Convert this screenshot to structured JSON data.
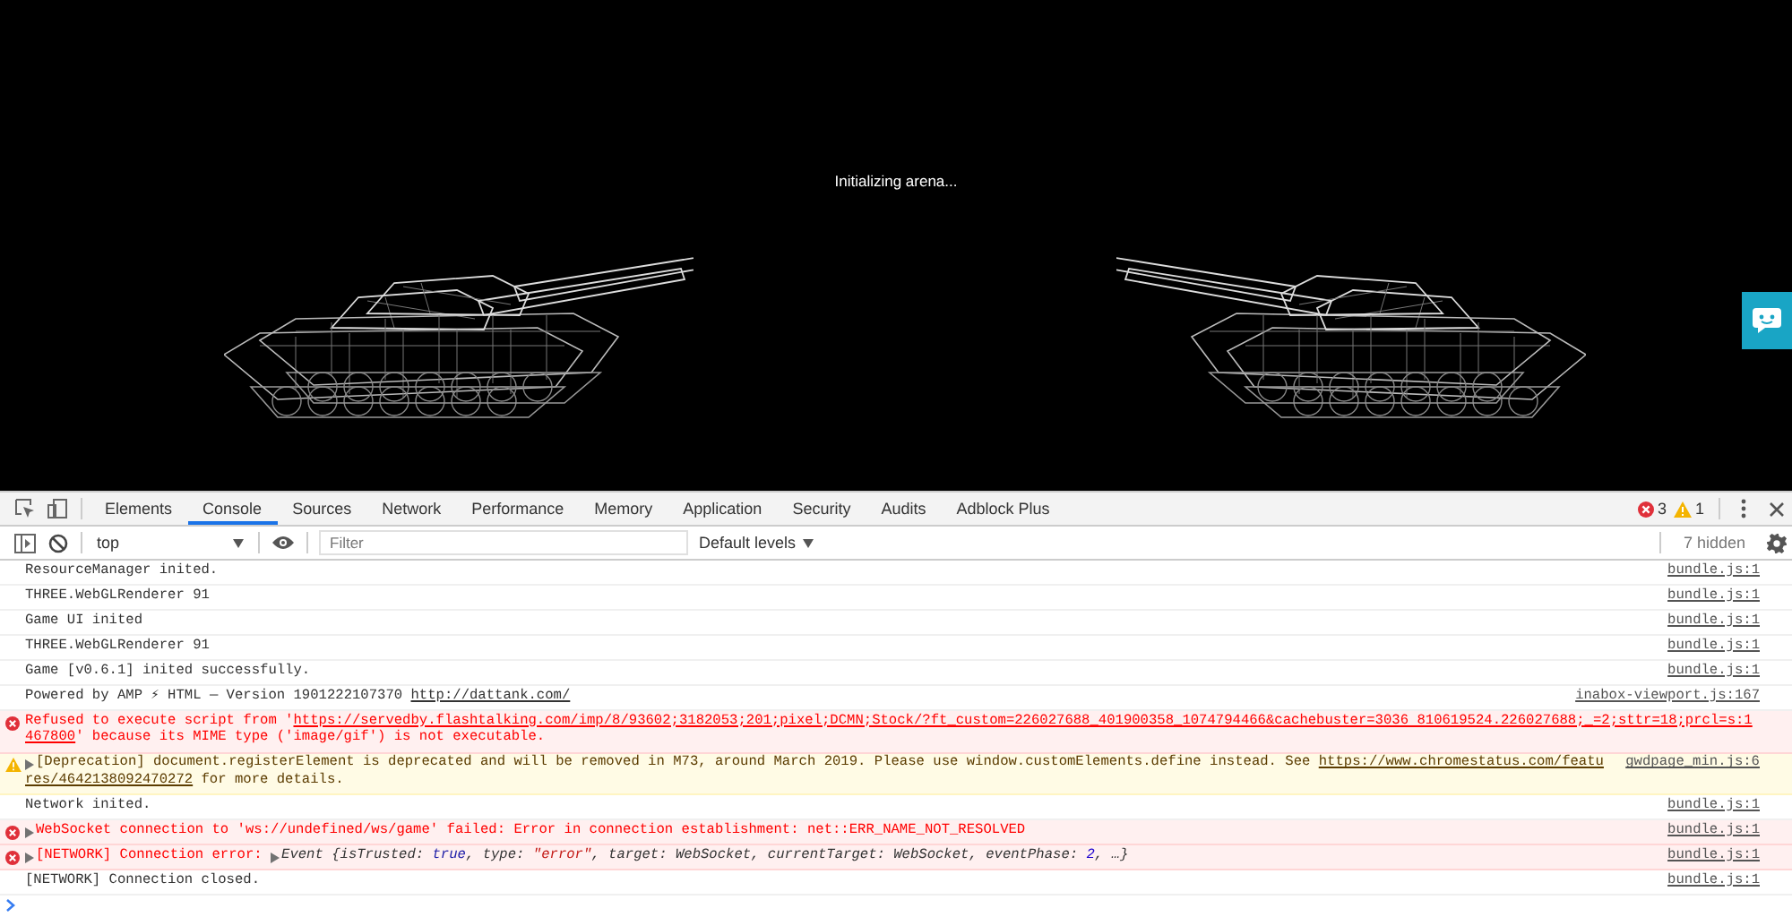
{
  "game": {
    "status": "Initializing arena..."
  },
  "devtools": {
    "tabs": [
      {
        "label": "Elements",
        "selected": false
      },
      {
        "label": "Console",
        "selected": true
      },
      {
        "label": "Sources",
        "selected": false
      },
      {
        "label": "Network",
        "selected": false
      },
      {
        "label": "Performance",
        "selected": false
      },
      {
        "label": "Memory",
        "selected": false
      },
      {
        "label": "Application",
        "selected": false
      },
      {
        "label": "Security",
        "selected": false
      },
      {
        "label": "Audits",
        "selected": false
      },
      {
        "label": "Adblock Plus",
        "selected": false
      }
    ],
    "error_count": "3",
    "warning_count": "1",
    "toolbar": {
      "context": "top",
      "filter": {
        "placeholder": "Filter"
      },
      "levels": "Default levels",
      "hidden": "7 hidden"
    },
    "console": [
      {
        "kind": "info",
        "expandable": false,
        "source": "bundle.js:1",
        "lines": [
          [
            {
              "kind": "text",
              "text": "ResourceManager inited."
            }
          ]
        ]
      },
      {
        "kind": "info",
        "expandable": false,
        "source": "bundle.js:1",
        "lines": [
          [
            {
              "kind": "text",
              "text": "THREE.WebGLRenderer 91"
            }
          ]
        ]
      },
      {
        "kind": "info",
        "expandable": false,
        "source": "bundle.js:1",
        "lines": [
          [
            {
              "kind": "text",
              "text": "Game UI inited"
            }
          ]
        ]
      },
      {
        "kind": "info",
        "expandable": false,
        "source": "bundle.js:1",
        "lines": [
          [
            {
              "kind": "text",
              "text": "THREE.WebGLRenderer 91"
            }
          ]
        ]
      },
      {
        "kind": "info",
        "expandable": false,
        "source": "bundle.js:1",
        "lines": [
          [
            {
              "kind": "text",
              "text": "Game [v0.6.1] inited successfully."
            }
          ]
        ]
      },
      {
        "kind": "info",
        "expandable": false,
        "source": "inabox-viewport.js:167",
        "lines": [
          [
            {
              "kind": "text",
              "text": "Powered by AMP ⚡ HTML — Version 1901222107370 "
            },
            {
              "kind": "link",
              "text": "http://dattank.com/"
            }
          ]
        ]
      },
      {
        "kind": "error",
        "expandable": false,
        "lines": [
          [
            {
              "kind": "text",
              "text": "Refused to execute script from '"
            },
            {
              "kind": "link",
              "text": "https://servedby.flashtalking.com/imp/8/93602;3182053;201;pixel;DCMN;Stock/?ft_custom=226027688_401900358_1074794466&cachebuster=3036 810619524.226027688;_=2;sttr=18;prcl=s:1"
            }
          ],
          [
            {
              "kind": "link",
              "text": "467800"
            },
            {
              "kind": "text",
              "text": "' because its MIME type ('image/gif') is not executable."
            }
          ]
        ]
      },
      {
        "kind": "warning",
        "expandable": true,
        "source": "gwdpage_min.js:6",
        "lines": [
          [
            {
              "kind": "text",
              "text": "[Deprecation] document.registerElement is deprecated and will be removed in M73, around March 2019. Please use window.customElements.define instead. See "
            },
            {
              "kind": "link",
              "text": "https://www.chromestatus.com/featu"
            }
          ],
          [
            {
              "kind": "link",
              "text": "res/4642138092470272"
            },
            {
              "kind": "text",
              "text": " for more details."
            }
          ]
        ]
      },
      {
        "kind": "info",
        "expandable": false,
        "source": "bundle.js:1",
        "lines": [
          [
            {
              "kind": "text",
              "text": "Network inited."
            }
          ]
        ]
      },
      {
        "kind": "error",
        "expandable": true,
        "source": "bundle.js:1",
        "lines": [
          [
            {
              "kind": "text",
              "text": "WebSocket connection to 'ws://undefined/ws/game' failed: Error in connection establishment: net::ERR_NAME_NOT_RESOLVED"
            }
          ]
        ]
      },
      {
        "kind": "error",
        "expandable": true,
        "source": "bundle.js:1",
        "lines": [
          [
            {
              "kind": "text",
              "text": "[NETWORK] Connection error: "
            },
            {
              "kind": "toggle"
            },
            {
              "kind": "object",
              "text": "Event {isTrusted: "
            },
            {
              "kind": "bool",
              "text": "true"
            },
            {
              "kind": "object",
              "text": ", type: "
            },
            {
              "kind": "string",
              "text": "\"error\""
            },
            {
              "kind": "object",
              "text": ", target: WebSocket, currentTarget: WebSocket, eventPhase: "
            },
            {
              "kind": "number",
              "text": "2"
            },
            {
              "kind": "object",
              "text": ", …}"
            }
          ]
        ]
      },
      {
        "kind": "info",
        "expandable": false,
        "source": "bundle.js:1",
        "lines": [
          [
            {
              "kind": "text",
              "text": "[NETWORK] Connection closed."
            }
          ]
        ]
      }
    ]
  }
}
